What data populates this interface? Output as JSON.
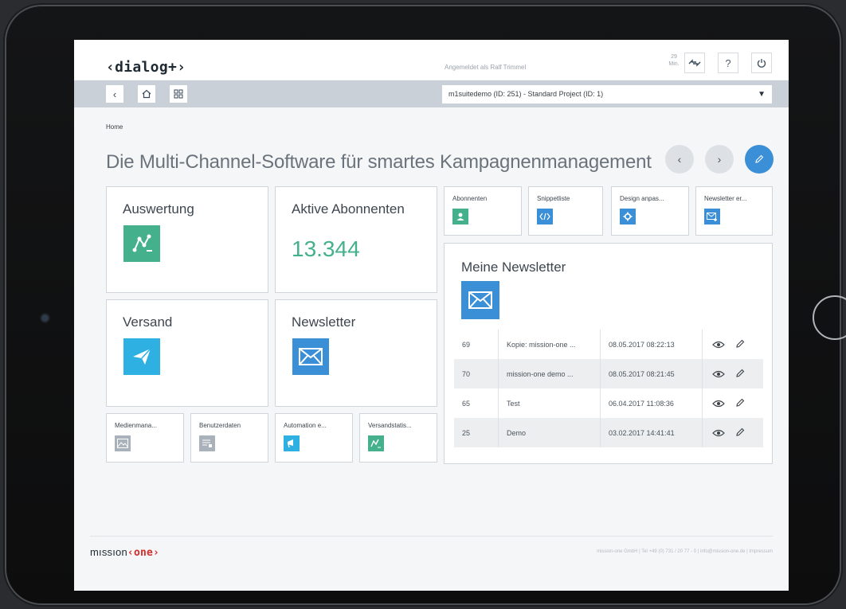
{
  "app": {
    "logo": "‹dialog+›",
    "logged_in": "Angemeldet als Ralf Trimmel",
    "session_timer_value": "29",
    "session_timer_unit": "Min.",
    "project_select": "m1suitedemo (ID: 251) - Standard Project (ID: 1)",
    "breadcrumb": "Home",
    "page_title": "Die Multi-Channel-Software für smartes Kampagnenmanagement"
  },
  "icons": {
    "refresh": "refresh-icon",
    "help": "help-icon",
    "power": "power-icon",
    "back": "back-icon",
    "home": "home-icon",
    "grid": "grid-icon"
  },
  "tiles": {
    "auswertung": {
      "title": "Auswertung"
    },
    "abonnenten": {
      "title": "Aktive Abonnenten",
      "value": "13.344"
    },
    "versand": {
      "title": "Versand"
    },
    "newsletter": {
      "title": "Newsletter"
    }
  },
  "small_tiles": [
    {
      "label": "Medienmana..."
    },
    {
      "label": "Benutzerdaten"
    },
    {
      "label": "Automation e..."
    },
    {
      "label": "Versandstatis..."
    }
  ],
  "quick_tiles": [
    {
      "label": "Abonnenten"
    },
    {
      "label": "Snippetliste"
    },
    {
      "label": "Design anpas..."
    },
    {
      "label": "Newsletter er..."
    }
  ],
  "my_newsletters": {
    "title": "Meine Newsletter",
    "rows": [
      {
        "id": "69",
        "name": "Kopie: mission-one ...",
        "date": "08.05.2017 08:22:13"
      },
      {
        "id": "70",
        "name": "mission-one demo ...",
        "date": "08.05.2017 08:21:45"
      },
      {
        "id": "65",
        "name": "Test",
        "date": "06.04.2017 11:08:36"
      },
      {
        "id": "25",
        "name": "Demo",
        "date": "03.02.2017 14:41:41"
      }
    ]
  },
  "footer": {
    "logo_a": "mıssıon",
    "logo_b": "‹one›",
    "text": "mission-one GmbH | Tel +49 (0) 731 / 20 77 - 0 | info@mission-one.de | Impressum"
  },
  "colors": {
    "accent_blue": "#3a8fd6",
    "accent_green": "#45b08c",
    "accent_sky": "#2fb0e2"
  }
}
